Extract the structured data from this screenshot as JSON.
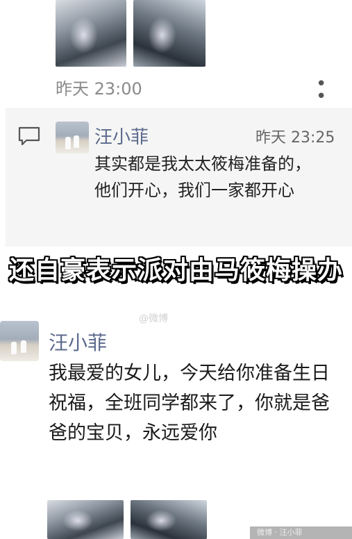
{
  "post1": {
    "images": [
      {
        "alt": "photo-1"
      },
      {
        "alt": "photo-2"
      }
    ],
    "timestamp": "昨天 23:00",
    "more_icon": "more-dots-icon"
  },
  "comment": {
    "icon": "comment-icon",
    "author": "汪小菲",
    "time": "昨天 23:25",
    "text": "其实都是我太太筱梅准备的，他们开心，我们一家都开心"
  },
  "caption": "还自豪表示派对由马筱梅操办",
  "post2": {
    "author": "汪小菲",
    "text": "我最爱的女儿，今天给你准备生日祝福，全班同学都来了，你就是爸爸的宝贝，永远爱你",
    "images": [
      {
        "alt": "photo-3"
      },
      {
        "alt": "photo-4"
      }
    ]
  },
  "watermark": "@微博",
  "footer_tag": "微博 · 汪小菲"
}
